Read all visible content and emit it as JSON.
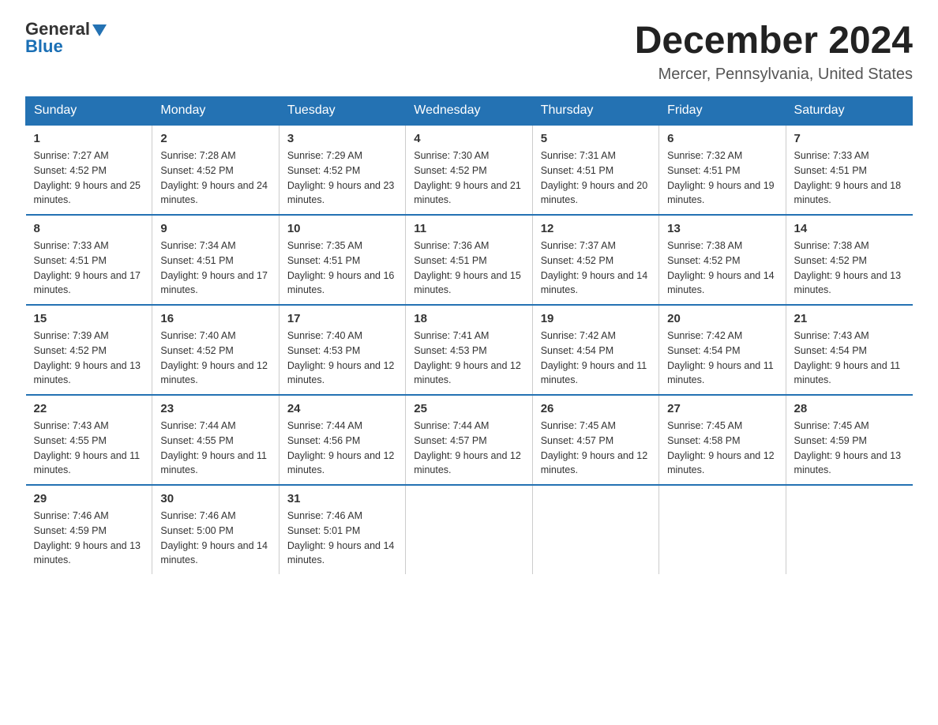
{
  "header": {
    "logo_line1": "General",
    "logo_line2": "Blue",
    "month_title": "December 2024",
    "location": "Mercer, Pennsylvania, United States"
  },
  "weekdays": [
    "Sunday",
    "Monday",
    "Tuesday",
    "Wednesday",
    "Thursday",
    "Friday",
    "Saturday"
  ],
  "weeks": [
    [
      {
        "num": "1",
        "sunrise": "7:27 AM",
        "sunset": "4:52 PM",
        "daylight": "9 hours and 25 minutes."
      },
      {
        "num": "2",
        "sunrise": "7:28 AM",
        "sunset": "4:52 PM",
        "daylight": "9 hours and 24 minutes."
      },
      {
        "num": "3",
        "sunrise": "7:29 AM",
        "sunset": "4:52 PM",
        "daylight": "9 hours and 23 minutes."
      },
      {
        "num": "4",
        "sunrise": "7:30 AM",
        "sunset": "4:52 PM",
        "daylight": "9 hours and 21 minutes."
      },
      {
        "num": "5",
        "sunrise": "7:31 AM",
        "sunset": "4:51 PM",
        "daylight": "9 hours and 20 minutes."
      },
      {
        "num": "6",
        "sunrise": "7:32 AM",
        "sunset": "4:51 PM",
        "daylight": "9 hours and 19 minutes."
      },
      {
        "num": "7",
        "sunrise": "7:33 AM",
        "sunset": "4:51 PM",
        "daylight": "9 hours and 18 minutes."
      }
    ],
    [
      {
        "num": "8",
        "sunrise": "7:33 AM",
        "sunset": "4:51 PM",
        "daylight": "9 hours and 17 minutes."
      },
      {
        "num": "9",
        "sunrise": "7:34 AM",
        "sunset": "4:51 PM",
        "daylight": "9 hours and 17 minutes."
      },
      {
        "num": "10",
        "sunrise": "7:35 AM",
        "sunset": "4:51 PM",
        "daylight": "9 hours and 16 minutes."
      },
      {
        "num": "11",
        "sunrise": "7:36 AM",
        "sunset": "4:51 PM",
        "daylight": "9 hours and 15 minutes."
      },
      {
        "num": "12",
        "sunrise": "7:37 AM",
        "sunset": "4:52 PM",
        "daylight": "9 hours and 14 minutes."
      },
      {
        "num": "13",
        "sunrise": "7:38 AM",
        "sunset": "4:52 PM",
        "daylight": "9 hours and 14 minutes."
      },
      {
        "num": "14",
        "sunrise": "7:38 AM",
        "sunset": "4:52 PM",
        "daylight": "9 hours and 13 minutes."
      }
    ],
    [
      {
        "num": "15",
        "sunrise": "7:39 AM",
        "sunset": "4:52 PM",
        "daylight": "9 hours and 13 minutes."
      },
      {
        "num": "16",
        "sunrise": "7:40 AM",
        "sunset": "4:52 PM",
        "daylight": "9 hours and 12 minutes."
      },
      {
        "num": "17",
        "sunrise": "7:40 AM",
        "sunset": "4:53 PM",
        "daylight": "9 hours and 12 minutes."
      },
      {
        "num": "18",
        "sunrise": "7:41 AM",
        "sunset": "4:53 PM",
        "daylight": "9 hours and 12 minutes."
      },
      {
        "num": "19",
        "sunrise": "7:42 AM",
        "sunset": "4:54 PM",
        "daylight": "9 hours and 11 minutes."
      },
      {
        "num": "20",
        "sunrise": "7:42 AM",
        "sunset": "4:54 PM",
        "daylight": "9 hours and 11 minutes."
      },
      {
        "num": "21",
        "sunrise": "7:43 AM",
        "sunset": "4:54 PM",
        "daylight": "9 hours and 11 minutes."
      }
    ],
    [
      {
        "num": "22",
        "sunrise": "7:43 AM",
        "sunset": "4:55 PM",
        "daylight": "9 hours and 11 minutes."
      },
      {
        "num": "23",
        "sunrise": "7:44 AM",
        "sunset": "4:55 PM",
        "daylight": "9 hours and 11 minutes."
      },
      {
        "num": "24",
        "sunrise": "7:44 AM",
        "sunset": "4:56 PM",
        "daylight": "9 hours and 12 minutes."
      },
      {
        "num": "25",
        "sunrise": "7:44 AM",
        "sunset": "4:57 PM",
        "daylight": "9 hours and 12 minutes."
      },
      {
        "num": "26",
        "sunrise": "7:45 AM",
        "sunset": "4:57 PM",
        "daylight": "9 hours and 12 minutes."
      },
      {
        "num": "27",
        "sunrise": "7:45 AM",
        "sunset": "4:58 PM",
        "daylight": "9 hours and 12 minutes."
      },
      {
        "num": "28",
        "sunrise": "7:45 AM",
        "sunset": "4:59 PM",
        "daylight": "9 hours and 13 minutes."
      }
    ],
    [
      {
        "num": "29",
        "sunrise": "7:46 AM",
        "sunset": "4:59 PM",
        "daylight": "9 hours and 13 minutes."
      },
      {
        "num": "30",
        "sunrise": "7:46 AM",
        "sunset": "5:00 PM",
        "daylight": "9 hours and 14 minutes."
      },
      {
        "num": "31",
        "sunrise": "7:46 AM",
        "sunset": "5:01 PM",
        "daylight": "9 hours and 14 minutes."
      },
      null,
      null,
      null,
      null
    ]
  ]
}
